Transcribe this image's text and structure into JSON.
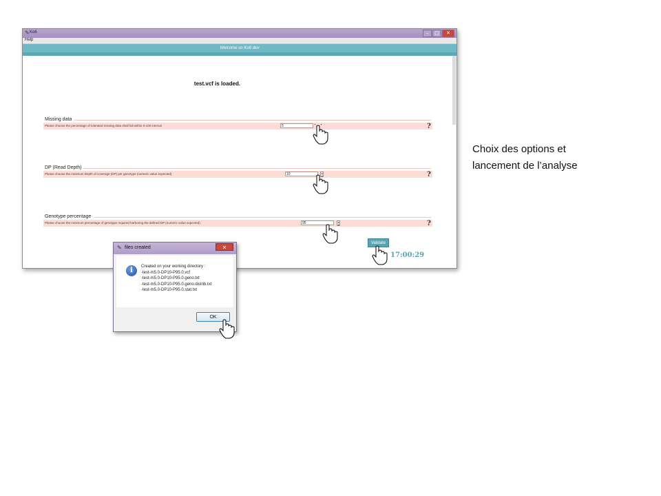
{
  "window": {
    "title": "Ko6",
    "menu_help": "Help",
    "welcome": "Welcome on Ko6 dev",
    "loaded_message": "test.vcf is loaded."
  },
  "panels": [
    {
      "title": "Missing data",
      "description": "Please choose the percentage of tolerated missing data shall fall within 0-100 interval",
      "value": "5",
      "help": "?"
    },
    {
      "title": "DP (Read Depth)",
      "description": "Please choose the minimum Depth of coverage (DP) per genotype (numeric value expected)",
      "value": "10",
      "help": "?"
    },
    {
      "title": "Genotype percentage",
      "description": "Please choose the minimum percentage of genotype required harboring the defined DP (numeric value expected)",
      "value": "95",
      "help": "?"
    }
  ],
  "validate_label": "Validate",
  "clock": "17:00:29",
  "dialog": {
    "title": "files created",
    "close": "✕",
    "info_icon": "info-icon",
    "lines": [
      "Created on your working directory :",
      "-test-m5.0-DP10-P95.0.vcf",
      "-test-m5.0-DP10-P95.0.geno.txt",
      "-test-m5.0-DP10-P95.0.geno.distrib.txt",
      "-test-m5.0-DP10-P95.0.stat.txt"
    ],
    "ok": "OK"
  },
  "caption": {
    "line1": "Choix des options et",
    "line2": "lancement de l’analyse"
  },
  "colors": {
    "accent": "#5aa4af",
    "panel_bg": "#fcdcd4",
    "titlebar": "#b09cc8"
  }
}
